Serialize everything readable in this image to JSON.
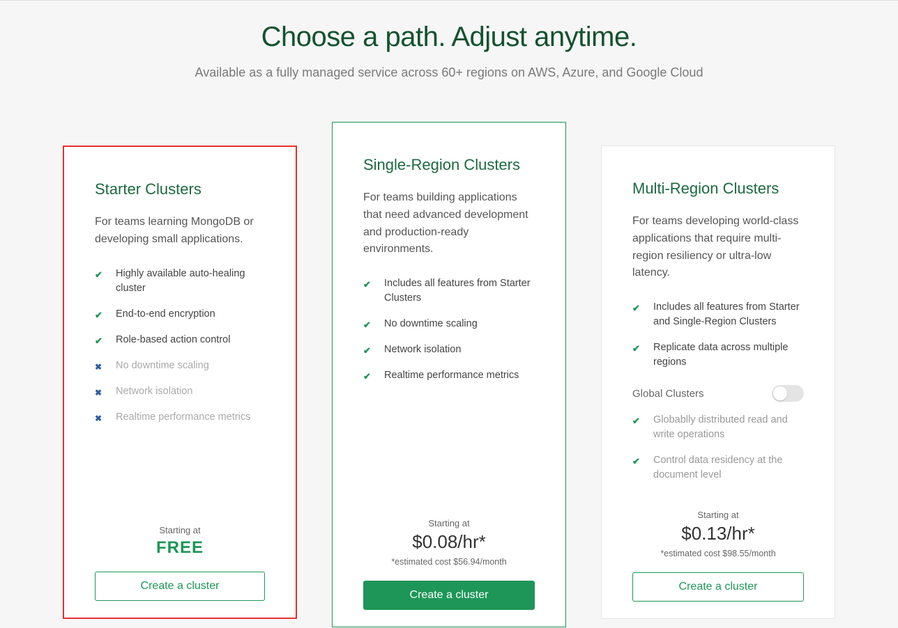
{
  "header": {
    "title": "Choose a path. Adjust anytime.",
    "subtitle": "Available as a fully managed service across 60+ regions on AWS, Azure, and Google Cloud"
  },
  "plans": {
    "starter": {
      "title": "Starter Clusters",
      "desc": "For teams learning MongoDB or developing small applications.",
      "features": [
        {
          "icon": "check",
          "text": "Highly available auto-healing cluster",
          "state": "on"
        },
        {
          "icon": "check",
          "text": "End-to-end encryption",
          "state": "on"
        },
        {
          "icon": "check",
          "text": "Role-based action control",
          "state": "on"
        },
        {
          "icon": "x",
          "text": "No downtime scaling",
          "state": "off"
        },
        {
          "icon": "x",
          "text": "Network isolation",
          "state": "off"
        },
        {
          "icon": "x",
          "text": "Realtime performance metrics",
          "state": "off"
        }
      ],
      "starting_label": "Starting at",
      "price": "FREE",
      "cta": "Create a cluster"
    },
    "single": {
      "title": "Single-Region Clusters",
      "desc": "For teams building applications that need advanced development and production-ready environments.",
      "features": [
        {
          "icon": "check",
          "text": "Includes all features from Starter Clusters",
          "state": "on"
        },
        {
          "icon": "check",
          "text": "No downtime scaling",
          "state": "on"
        },
        {
          "icon": "check",
          "text": "Network isolation",
          "state": "on"
        },
        {
          "icon": "check",
          "text": "Realtime performance metrics",
          "state": "on"
        }
      ],
      "starting_label": "Starting at",
      "price": "$0.08/hr*",
      "estimate": "*estimated cost $56.94/month",
      "cta": "Create a cluster"
    },
    "multi": {
      "title": "Multi-Region Clusters",
      "desc": "For teams developing world-class applications that require multi-region resiliency or ultra-low latency.",
      "features_top": [
        {
          "icon": "check",
          "text": "Includes all features from Starter and Single-Region Clusters",
          "state": "on"
        },
        {
          "icon": "check",
          "text": "Replicate data across multiple regions",
          "state": "on"
        }
      ],
      "global_label": "Global Clusters",
      "features_global": [
        {
          "icon": "check",
          "text": "Globablly distributed read and write operations",
          "state": "muted"
        },
        {
          "icon": "check",
          "text": "Control data residency at the document level",
          "state": "muted"
        }
      ],
      "starting_label": "Starting at",
      "price": "$0.13/hr*",
      "estimate": "*estimated cost $98.55/month",
      "cta": "Create a cluster"
    }
  }
}
